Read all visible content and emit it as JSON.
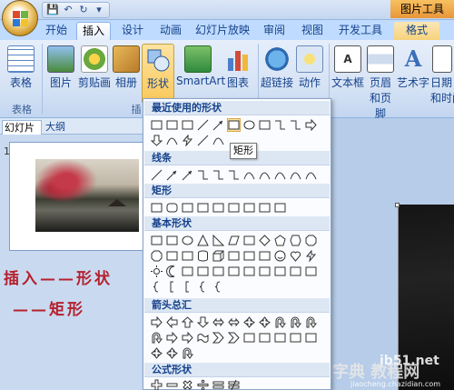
{
  "window": {
    "contextual_tab": "图片工具"
  },
  "quick_access": {
    "save": "💾",
    "undo": "↶",
    "redo": "↻",
    "customize": "▾"
  },
  "tabs": [
    {
      "label": "开始"
    },
    {
      "label": "插入"
    },
    {
      "label": "设计"
    },
    {
      "label": "动画"
    },
    {
      "label": "幻灯片放映"
    },
    {
      "label": "审阅"
    },
    {
      "label": "视图"
    },
    {
      "label": "开发工具"
    },
    {
      "label": "格式"
    }
  ],
  "active_tab": "插入",
  "ribbon": {
    "buttons": [
      {
        "label": "表格",
        "icon": "table-icon"
      },
      {
        "label": "图片",
        "icon": "picture-icon"
      },
      {
        "label": "剪贴画",
        "icon": "clipart-icon"
      },
      {
        "label": "相册",
        "icon": "album-icon"
      },
      {
        "label": "形状",
        "icon": "shapes-icon"
      },
      {
        "label": "SmartArt",
        "icon": "smartart-icon"
      },
      {
        "label": "图表",
        "icon": "chart-icon"
      },
      {
        "label": "超链接",
        "icon": "hyperlink-icon"
      },
      {
        "label": "动作",
        "icon": "action-icon"
      },
      {
        "label": "文本框",
        "icon": "textbox-icon"
      },
      {
        "label": "页眉",
        "sub": "和页脚",
        "icon": "header-footer-icon"
      },
      {
        "label": "艺术字",
        "icon": "wordart-icon"
      },
      {
        "label": "日期",
        "sub": "和时间",
        "icon": "datetime-icon"
      }
    ],
    "groups": [
      {
        "label": "表格"
      },
      {
        "label": "插"
      }
    ]
  },
  "left_pane": {
    "tabs": [
      {
        "label": "幻灯片"
      },
      {
        "label": "大纲"
      }
    ],
    "slide_number": "1",
    "annotation_line1": "插入——形状",
    "annotation_line2": "——矩形"
  },
  "shapes_menu": {
    "sections": [
      {
        "title": "最近使用的形状"
      },
      {
        "title": "线条"
      },
      {
        "title": "矩形"
      },
      {
        "title": "基本形状"
      },
      {
        "title": "箭头总汇"
      },
      {
        "title": "公式形状"
      }
    ],
    "tooltip": "矩形"
  },
  "watermark": {
    "site": "jb51.net",
    "brand": "查字典",
    "sub": "教程网",
    "url": "jiaocheng.chazidian.com"
  },
  "colors": {
    "ribbon_bg": "#d6e3f5",
    "accent": "#15428b",
    "pressed": "#fbc85a",
    "annotation": "#b5212e",
    "contextual": "#e8963a"
  }
}
